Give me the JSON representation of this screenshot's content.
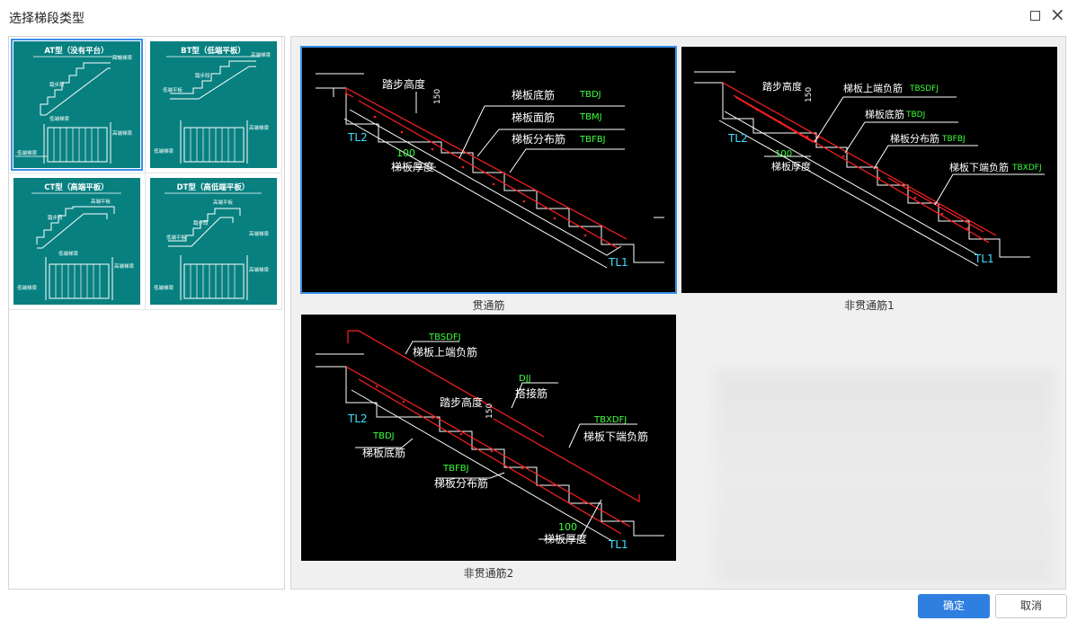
{
  "dialog": {
    "title": "选择梯段类型",
    "ok_label": "确定",
    "cancel_label": "取消"
  },
  "types": [
    {
      "id": "AT",
      "title": "AT型（没有平台）",
      "selected": true,
      "labels": {
        "top_beam": "高端梯梁",
        "step_height": "踏步段",
        "bot_beam": "低端梯梁",
        "high_beam2": "高端梯梁",
        "low_beam2": "低端梯梁"
      }
    },
    {
      "id": "BT",
      "title": "BT型（低端平板）",
      "selected": false,
      "labels": {
        "top_beam": "高端梯梁",
        "step_height": "踏步段",
        "low_platform": "低端平板",
        "high_beam2": "高端梯梁",
        "low_beam2": "低端梯梁"
      }
    },
    {
      "id": "CT",
      "title": "CT型（高端平板）",
      "selected": false,
      "labels": {
        "top_beam": "高端平板",
        "step_height": "踏步段",
        "bot_beam": "低端梯梁",
        "high_beam2": "高端梯梁",
        "low_beam2": "低端梯梁"
      }
    },
    {
      "id": "DT",
      "title": "DT型（高低端平板）",
      "selected": false,
      "labels": {
        "top_beam": "高端平板",
        "step_height": "踏步段",
        "low_platform": "低端平板",
        "high_beam": "高端梯梁",
        "high_beam2": "高端梯梁",
        "low_beam2": "低端梯梁"
      }
    }
  ],
  "options": [
    {
      "caption": "贯通筋",
      "selected": true,
      "labels": {
        "step_height": "踏步高度",
        "step_val": "150",
        "bottom": "梯板底筋",
        "bottom_code": "TBDJ",
        "top": "梯板面筋",
        "top_code": "TBMJ",
        "dist": "梯板分布筋",
        "dist_code": "TBFBJ",
        "thick_val": "100",
        "thick": "梯板厚度",
        "tl2": "TL2",
        "tl1": "TL1"
      }
    },
    {
      "caption": "非贯通筋1",
      "selected": false,
      "labels": {
        "step_height": "踏步高度",
        "step_val": "150",
        "upper": "梯板上端负筋",
        "upper_code": "TBSDFJ",
        "bottom": "梯板底筋",
        "bottom_code": "TBDJ",
        "dist": "梯板分布筋",
        "dist_code": "TBFBJ",
        "lower": "梯板下端负筋",
        "lower_code": "TBXDFJ",
        "thick_val": "100",
        "thick": "梯板厚度",
        "tl2": "TL2",
        "tl1": "TL1"
      }
    },
    {
      "caption": "非贯通筋2",
      "selected": false,
      "labels": {
        "upper_code": "TBSDFJ",
        "upper": "梯板上端负筋",
        "lap_code": "DJJ",
        "lap": "搭接筋",
        "step_height": "踏步高度",
        "step_val": "150",
        "lower_code": "TBXDFJ",
        "lower": "梯板下端负筋",
        "bottom_code": "TBDJ",
        "bottom": "梯板底筋",
        "dist_code": "TBFBJ",
        "dist": "梯板分布筋",
        "thick_val": "100",
        "thick": "梯板厚度",
        "tl2": "TL2",
        "tl1": "TL1"
      }
    }
  ],
  "colors": {
    "accent": "#2f7fe0",
    "thumb_bg": "#088080",
    "cad_bg": "#000000",
    "cad_white": "#ffffff",
    "cad_red": "#ff2020",
    "cad_green": "#3cff3c",
    "cad_cyan": "#40e0ff"
  }
}
